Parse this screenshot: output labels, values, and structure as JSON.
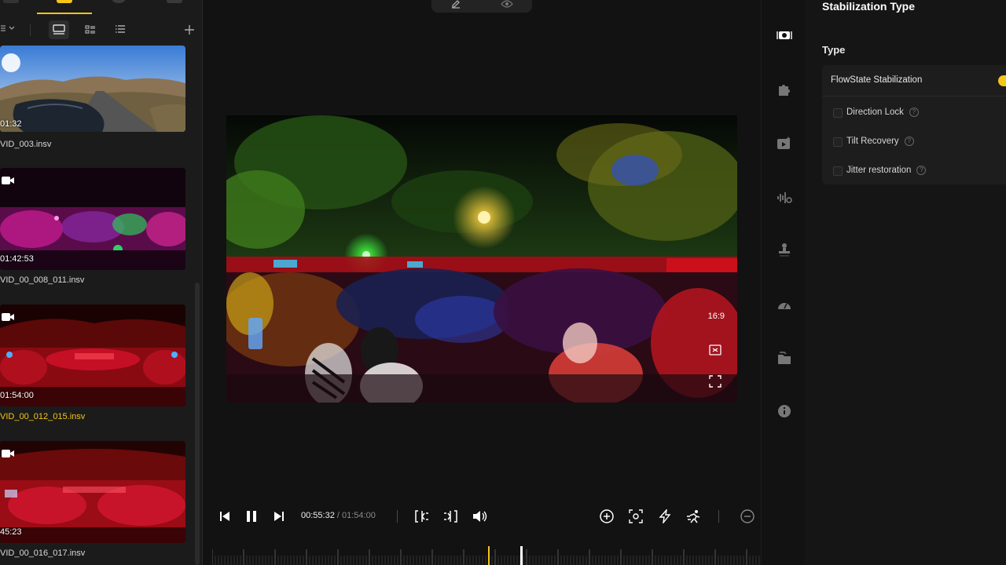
{
  "media": {
    "clips": [
      {
        "duration": "01:32",
        "name": "VID_003.insv",
        "active": false
      },
      {
        "duration": "01:42:53",
        "name": "VID_00_008_011.insv",
        "active": false
      },
      {
        "duration": "01:54:00",
        "name": "VID_00_012_015.insv",
        "active": true
      },
      {
        "duration": "45:23",
        "name": "VID_00_016_017.insv",
        "active": false
      }
    ]
  },
  "preview": {
    "aspect_ratio": "16:9"
  },
  "playback": {
    "current_time": "00:55:32",
    "separator": " / ",
    "total_time": "01:54:00"
  },
  "settings": {
    "title": "Stabilization Type",
    "type_label": "Type",
    "flowstate_label": "FlowState Stabilization",
    "flowstate_on": true,
    "options": [
      {
        "label": "Direction Lock",
        "checked": false
      },
      {
        "label": "Tilt Recovery",
        "checked": false
      },
      {
        "label": "Jitter restoration",
        "checked": false
      }
    ]
  },
  "colors": {
    "accent": "#f5c518",
    "panel": "#1b1b1b",
    "background": "#121212"
  }
}
